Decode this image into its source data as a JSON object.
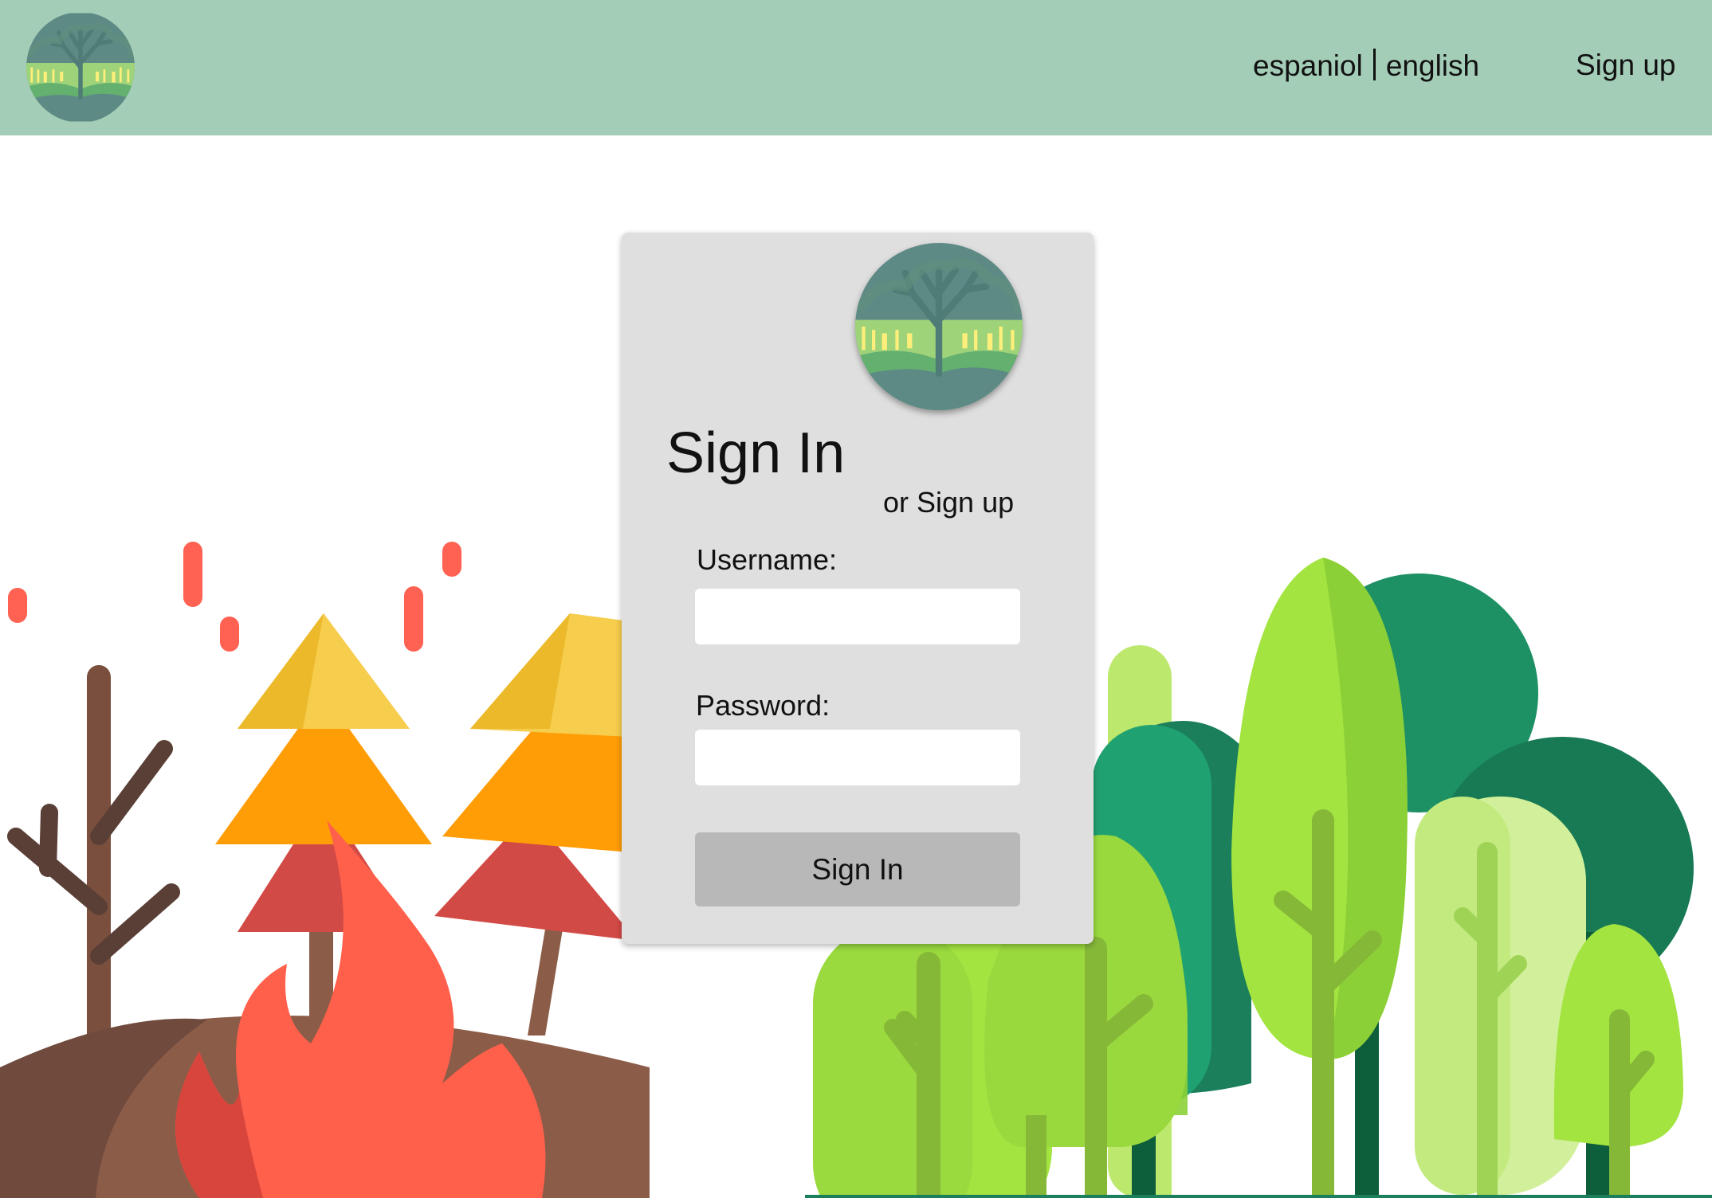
{
  "header": {
    "lang_es": "espaniol",
    "lang_en": "english",
    "signup_link": "Sign up"
  },
  "login": {
    "title": "Sign In",
    "alt_link": "or Sign up",
    "username_label": "Username:",
    "username_value": "",
    "password_label": "Password:",
    "password_value": "",
    "submit_label": "Sign In"
  },
  "colors": {
    "header_bg": "#a3cdb7",
    "card_bg": "#dfdfdf",
    "button_bg": "#b8b8b8"
  }
}
